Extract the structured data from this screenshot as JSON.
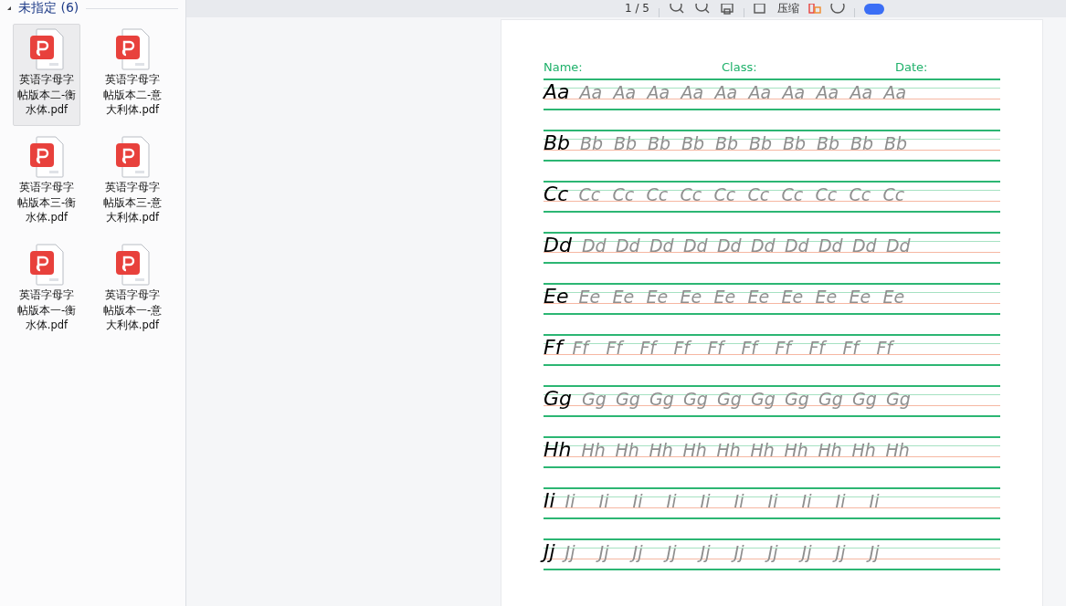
{
  "sidebar": {
    "group_title": "未指定 (6)",
    "files": [
      {
        "name": "英语字母字帖版本二-衡水体.pdf",
        "selected": true
      },
      {
        "name": "英语字母字帖版本二-意大利体.pdf",
        "selected": false
      },
      {
        "name": "英语字母字帖版本三-衡水体.pdf",
        "selected": false
      },
      {
        "name": "英语字母字帖版本三-意大利体.pdf",
        "selected": false
      },
      {
        "name": "英语字母字帖版本一-衡水体.pdf",
        "selected": false
      },
      {
        "name": "英语字母字帖版本一-意大利体.pdf",
        "selected": false
      }
    ]
  },
  "toolbar": {
    "page_counter": "1 / 5",
    "compress": "压缩",
    "toggle_on": true
  },
  "worksheet": {
    "header": [
      "Name:",
      "Class:",
      "Date:"
    ],
    "rows": [
      {
        "model": "Aa",
        "traces": [
          "Aa",
          "Aa",
          "Aa",
          "Aa",
          "Aa",
          "Aa",
          "Aa",
          "Aa",
          "Aa",
          "Aa"
        ]
      },
      {
        "model": "Bb",
        "traces": [
          "Bb",
          "Bb",
          "Bb",
          "Bb",
          "Bb",
          "Bb",
          "Bb",
          "Bb",
          "Bb",
          "Bb"
        ]
      },
      {
        "model": "Cc",
        "traces": [
          "Cc",
          "Cc",
          "Cc",
          "Cc",
          "Cc",
          "Cc",
          "Cc",
          "Cc",
          "Cc",
          "Cc"
        ]
      },
      {
        "model": "Dd",
        "traces": [
          "Dd",
          "Dd",
          "Dd",
          "Dd",
          "Dd",
          "Dd",
          "Dd",
          "Dd",
          "Dd",
          "Dd"
        ]
      },
      {
        "model": "Ee",
        "traces": [
          "Ee",
          "Ee",
          "Ee",
          "Ee",
          "Ee",
          "Ee",
          "Ee",
          "Ee",
          "Ee",
          "Ee"
        ]
      },
      {
        "model": "Ff",
        "traces": [
          "Ff",
          "Ff",
          "Ff",
          "Ff",
          "Ff",
          "Ff",
          "Ff",
          "Ff",
          "Ff",
          "Ff"
        ]
      },
      {
        "model": "Gg",
        "traces": [
          "Gg",
          "Gg",
          "Gg",
          "Gg",
          "Gg",
          "Gg",
          "Gg",
          "Gg",
          "Gg",
          "Gg"
        ]
      },
      {
        "model": "Hh",
        "traces": [
          "Hh",
          "Hh",
          "Hh",
          "Hh",
          "Hh",
          "Hh",
          "Hh",
          "Hh",
          "Hh",
          "Hh"
        ]
      },
      {
        "model": "Ii",
        "traces": [
          "Ii",
          "Ii",
          "Ii",
          "Ii",
          "Ii",
          "Ii",
          "Ii",
          "Ii",
          "Ii",
          "Ii"
        ]
      },
      {
        "model": "Jj",
        "traces": [
          "Jj",
          "Jj",
          "Jj",
          "Jj",
          "Jj",
          "Jj",
          "Jj",
          "Jj",
          "Jj",
          "Jj"
        ]
      }
    ]
  }
}
